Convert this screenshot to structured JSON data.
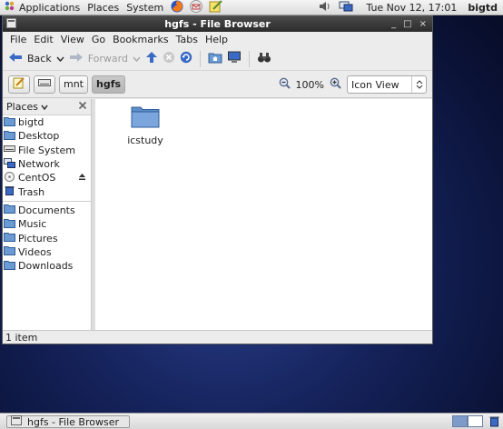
{
  "top_panel": {
    "applications_label": "Applications",
    "places_label": "Places",
    "system_label": "System",
    "clock": "Tue Nov 12, 17:01",
    "user": "bigtd"
  },
  "window": {
    "title": "hgfs - File Browser",
    "minimize_glyph": "_",
    "maximize_glyph": "□",
    "close_glyph": "×"
  },
  "menubar": [
    "File",
    "Edit",
    "View",
    "Go",
    "Bookmarks",
    "Tabs",
    "Help"
  ],
  "toolbar": {
    "back_label": "Back",
    "forward_label": "Forward"
  },
  "location": {
    "segments": [
      "mnt",
      "hgfs"
    ],
    "zoom": "100%",
    "view_mode": "Icon View"
  },
  "sidebar": {
    "header": "Places",
    "items": [
      {
        "label": "bigtd",
        "icon": "home-folder-icon"
      },
      {
        "label": "Desktop",
        "icon": "desktop-folder-icon"
      },
      {
        "label": "File System",
        "icon": "filesystem-icon"
      },
      {
        "label": "Network",
        "icon": "network-icon"
      },
      {
        "label": "CentOS",
        "icon": "cdrom-icon"
      },
      {
        "label": "Trash",
        "icon": "trash-icon"
      },
      {
        "label": "Documents",
        "icon": "folder-icon"
      },
      {
        "label": "Music",
        "icon": "folder-icon"
      },
      {
        "label": "Pictures",
        "icon": "folder-icon"
      },
      {
        "label": "Videos",
        "icon": "folder-icon"
      },
      {
        "label": "Downloads",
        "icon": "folder-icon"
      }
    ]
  },
  "files": [
    {
      "name": "icstudy",
      "type": "folder"
    }
  ],
  "status": "1 item",
  "taskbar": {
    "window_label": "hgfs - File Browser"
  },
  "colors": {
    "folder": "#6b9bd2",
    "desktop_bg": "#16245e",
    "titlebar": "#3a3a3a",
    "active_path": "#bdbdbd"
  }
}
